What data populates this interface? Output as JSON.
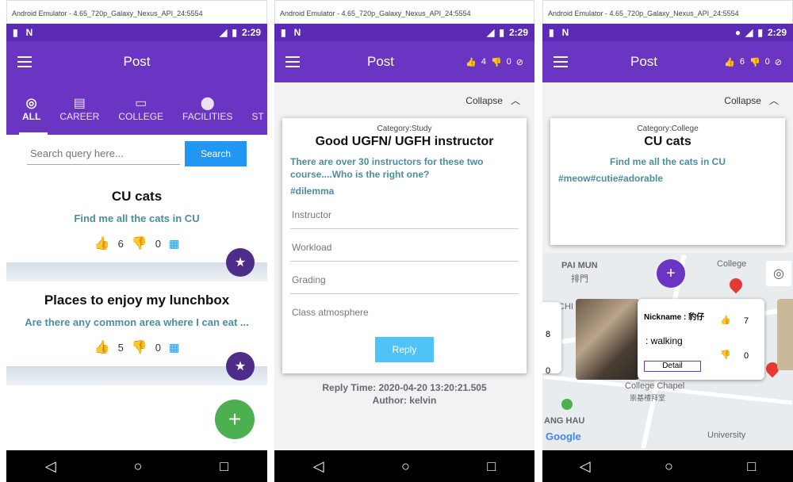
{
  "window_title": "Android Emulator - 4.65_720p_Galaxy_Nexus_API_24:5554",
  "status": {
    "time": "2:29"
  },
  "screen1": {
    "title": "Post",
    "tabs": [
      "ALL",
      "CAREER",
      "COLLEGE",
      "FACILITIES",
      "ST"
    ],
    "search_placeholder": "Search query here...",
    "search_button": "Search",
    "posts": [
      {
        "title": "CU cats",
        "desc": "Find me all the cats in CU",
        "up": "6",
        "down": "0"
      },
      {
        "title": "Places to enjoy my lunchbox",
        "desc": "Are there any common area where I can eat ...",
        "up": "5",
        "down": "0"
      }
    ],
    "fab": "+"
  },
  "screen2": {
    "title": "Post",
    "up": "4",
    "down": "0",
    "collapse": "Collapse",
    "category": "Category:Study",
    "post_title": "Good UGFN/ UGFH instructor",
    "text": "There are over 30 instructors for these two course....Who is the right one?",
    "tags": "#dilemma",
    "fields": [
      "Instructor",
      "Workload",
      "Grading",
      "Class atmosphere"
    ],
    "reply": "Reply",
    "reply_time": "Reply Time: 2020-04-20 13:20:21.505",
    "author": "Author: kelvin"
  },
  "screen3": {
    "title": "Post",
    "up": "6",
    "down": "0",
    "collapse": "Collapse",
    "category": "Category:College",
    "post_title": "CU cats",
    "text": "Find me all the cats in CU",
    "tags": "#meow#cutie#adorable",
    "map_labels": [
      "PAI MUN",
      "排門",
      "College",
      "CHI",
      "College Chapel",
      "崇基禮拜堂",
      "ANG HAU",
      "University"
    ],
    "popup": {
      "nickname": "Nickname : 豹仔",
      "status": ": walking",
      "up": "7",
      "down": "0",
      "detail": "Detail"
    },
    "google": "Google"
  }
}
